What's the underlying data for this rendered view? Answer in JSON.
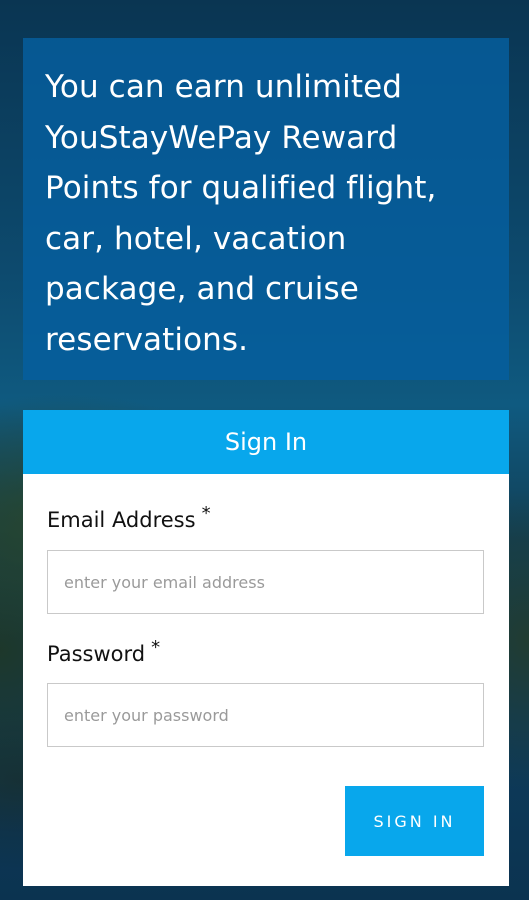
{
  "promo": {
    "text": "You can earn unlimited YouStayWePay Reward Points for qualified flight, car, hotel, vacation package, and cruise reservations."
  },
  "signin_card": {
    "title": "Sign In",
    "email": {
      "label": "Email Address",
      "required_mark": "*",
      "placeholder": "enter your email address",
      "value": ""
    },
    "password": {
      "label": "Password",
      "required_mark": "*",
      "placeholder": "enter your password",
      "value": ""
    },
    "submit_label": "SIGN IN"
  },
  "colors": {
    "accent": "#08a7ec",
    "promo_bg": "#055fa0",
    "card_bg": "#ffffff"
  }
}
